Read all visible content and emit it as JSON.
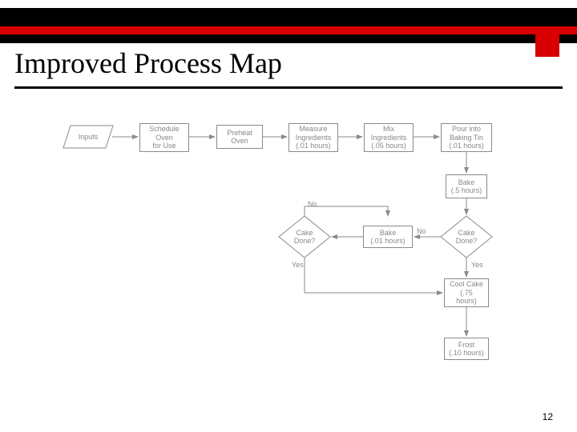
{
  "header": {
    "title": "Improved Process Map",
    "page_number": "12"
  },
  "flow": {
    "inputs": "Inputs",
    "schedule": "Schedule\nOven\nfor Use",
    "preheat": "Preheat\nOven",
    "measure": "Measure\nIngredients\n(.01 hours)",
    "mix": "Mix\nIngredients\n(.05 hours)",
    "pour": "Pour into\nBaking Tin\n(.01 hours)",
    "bake1": "Bake\n(.5 hours)",
    "done1": "Cake\nDone?",
    "bake2": "Bake\n(.01 hours)",
    "done2": "Cake\nDone?",
    "cool": "Cool Cake\n(.75\nhours)",
    "frost": "Frost\n(.10 hours)",
    "no": "No",
    "yes": "Yes"
  },
  "chart_data": {
    "type": "flowchart",
    "title": "Improved Process Map",
    "nodes": [
      {
        "id": "inputs",
        "type": "data",
        "label": "Inputs"
      },
      {
        "id": "schedule",
        "type": "process",
        "label": "Schedule Oven for Use"
      },
      {
        "id": "preheat",
        "type": "process",
        "label": "Preheat Oven"
      },
      {
        "id": "measure",
        "type": "process",
        "label": "Measure Ingredients",
        "duration_hours": 0.01
      },
      {
        "id": "mix",
        "type": "process",
        "label": "Mix Ingredients",
        "duration_hours": 0.05
      },
      {
        "id": "pour",
        "type": "process",
        "label": "Pour into Baking Tin",
        "duration_hours": 0.01
      },
      {
        "id": "bake1",
        "type": "process",
        "label": "Bake",
        "duration_hours": 0.5
      },
      {
        "id": "done1",
        "type": "decision",
        "label": "Cake Done?"
      },
      {
        "id": "bake2",
        "type": "process",
        "label": "Bake",
        "duration_hours": 0.01
      },
      {
        "id": "done2",
        "type": "decision",
        "label": "Cake Done?"
      },
      {
        "id": "cool",
        "type": "process",
        "label": "Cool Cake",
        "duration_hours": 0.75
      },
      {
        "id": "frost",
        "type": "process",
        "label": "Frost",
        "duration_hours": 0.1
      }
    ],
    "edges": [
      {
        "from": "inputs",
        "to": "schedule"
      },
      {
        "from": "schedule",
        "to": "preheat"
      },
      {
        "from": "preheat",
        "to": "measure"
      },
      {
        "from": "measure",
        "to": "mix"
      },
      {
        "from": "mix",
        "to": "pour"
      },
      {
        "from": "pour",
        "to": "bake1"
      },
      {
        "from": "bake1",
        "to": "done1"
      },
      {
        "from": "done1",
        "to": "bake2",
        "label": "No"
      },
      {
        "from": "bake2",
        "to": "done2"
      },
      {
        "from": "done2",
        "to": "done1",
        "label": "No"
      },
      {
        "from": "done1",
        "to": "cool",
        "label": "Yes"
      },
      {
        "from": "done2",
        "to": "cool",
        "label": "Yes"
      },
      {
        "from": "cool",
        "to": "frost"
      }
    ]
  }
}
